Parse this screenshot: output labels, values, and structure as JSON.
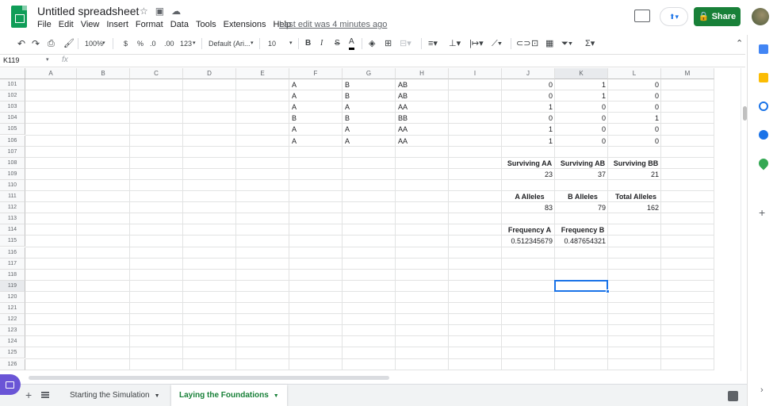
{
  "app": {
    "title": "Untitled spreadsheet",
    "menu": [
      "File",
      "Edit",
      "View",
      "Insert",
      "Format",
      "Data",
      "Tools",
      "Extensions",
      "Help"
    ],
    "last_edit": "Last edit was 4 minutes ago",
    "share_label": "Share",
    "share_icon": "lock-icon",
    "accent_color": "#188038",
    "selection_color": "#1a73e8"
  },
  "toolbar": {
    "zoom": "100%",
    "currency": "$",
    "percent": "%",
    "dec_decrease": ".0",
    "dec_increase": ".00",
    "format_more": "123",
    "font": "Default (Ari...",
    "font_size": "10",
    "bold": "B",
    "italic": "I",
    "strike": "S",
    "text_color": "A"
  },
  "formula_bar": {
    "name_box": "K119",
    "fx": "fx",
    "value": ""
  },
  "grid": {
    "columns": [
      "A",
      "B",
      "C",
      "D",
      "E",
      "F",
      "G",
      "H",
      "I",
      "J",
      "K",
      "L",
      "M"
    ],
    "selected_column": "K",
    "row_numbers": [
      "101",
      "102",
      "103",
      "104",
      "105",
      "106",
      "107",
      "108",
      "109",
      "110",
      "111",
      "112",
      "113",
      "114",
      "115",
      "116",
      "117",
      "118",
      "119",
      "120",
      "121",
      "122",
      "123",
      "124",
      "125",
      "126"
    ],
    "selected_row": "119",
    "genotype_rows": [
      {
        "f": "A",
        "g": "B",
        "h": "AB",
        "j": "0",
        "k": "1",
        "l": "0"
      },
      {
        "f": "A",
        "g": "B",
        "h": "AB",
        "j": "0",
        "k": "1",
        "l": "0"
      },
      {
        "f": "A",
        "g": "A",
        "h": "AA",
        "j": "1",
        "k": "0",
        "l": "0"
      },
      {
        "f": "B",
        "g": "B",
        "h": "BB",
        "j": "0",
        "k": "0",
        "l": "1"
      },
      {
        "f": "A",
        "g": "A",
        "h": "AA",
        "j": "1",
        "k": "0",
        "l": "0"
      },
      {
        "f": "A",
        "g": "A",
        "h": "AA",
        "j": "1",
        "k": "0",
        "l": "0"
      }
    ],
    "surviving": {
      "labels": [
        "Surviving AA",
        "Surviving AB",
        "Surviving BB"
      ],
      "values": [
        "23",
        "37",
        "21"
      ]
    },
    "alleles": {
      "labels": [
        "A Alleles",
        "B Alleles",
        "Total Alleles"
      ],
      "values": [
        "83",
        "79",
        "162"
      ]
    },
    "frequency": {
      "labels": [
        "Frequency A",
        "Frequency B"
      ],
      "values": [
        "0.512345679",
        "0.487654321"
      ]
    }
  },
  "sheets": {
    "tabs": [
      "Starting the Simulation",
      "Laying the Foundations"
    ],
    "active": "Laying the Foundations"
  }
}
